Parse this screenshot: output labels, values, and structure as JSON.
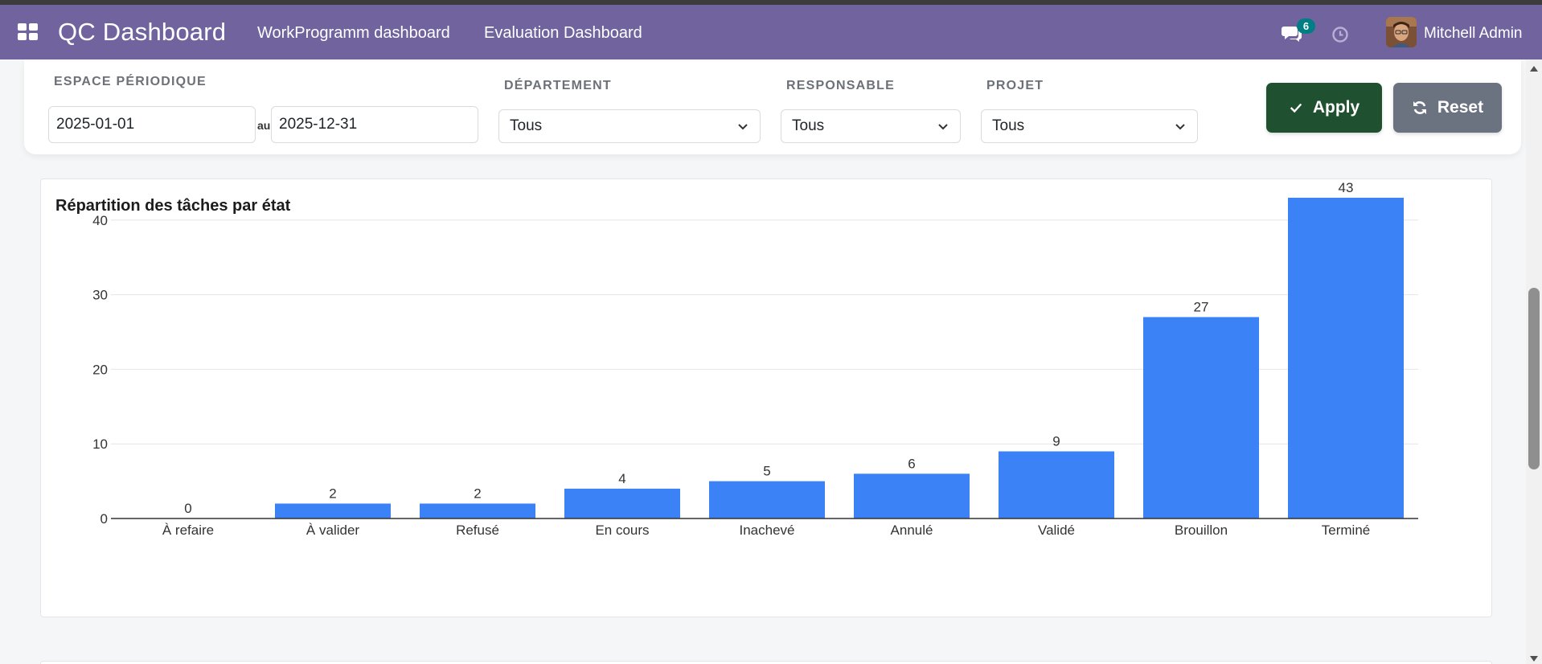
{
  "navbar": {
    "app_title": "QC Dashboard",
    "links": [
      "WorkProgramm dashboard",
      "Evaluation Dashboard"
    ],
    "messages_count": "6",
    "user_name": "Mitchell Admin",
    "background": "#71639e"
  },
  "filters": {
    "period_label": "ESPACE PÉRIODIQUE",
    "date_from": "2025-01-01",
    "between_text": "au",
    "date_to": "2025-12-31",
    "department_label": "DÉPARTEMENT",
    "department_value": "Tous",
    "responsible_label": "RESPONSABLE",
    "responsible_value": "Tous",
    "project_label": "PROJET",
    "project_value": "Tous",
    "apply_label": "Apply",
    "reset_label": "Reset",
    "apply_color": "#1f5130",
    "reset_color": "#6b7280"
  },
  "chart_data": {
    "type": "bar",
    "title": "Répartition des tâches par état",
    "categories": [
      "À refaire",
      "À valider",
      "Refusé",
      "En cours",
      "Inachevé",
      "Annulé",
      "Validé",
      "Brouillon",
      "Terminé"
    ],
    "values": [
      0,
      2,
      2,
      4,
      5,
      6,
      9,
      27,
      43
    ],
    "yticks": [
      0,
      10,
      20,
      30,
      40
    ],
    "ylim": [
      0,
      45
    ],
    "grid": true,
    "bar_color": "#3b82f6",
    "data_labels": true
  }
}
